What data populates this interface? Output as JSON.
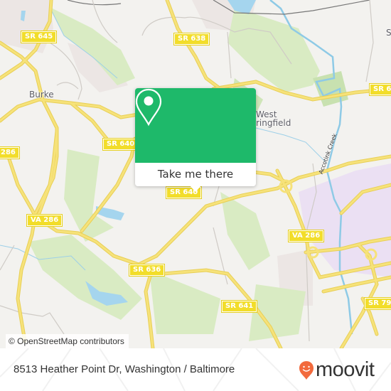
{
  "map": {
    "road_labels": [
      {
        "id": "sr645",
        "text": "SR 645"
      },
      {
        "id": "sr638",
        "text": "SR 638"
      },
      {
        "id": "sr64x",
        "text": "SR 64"
      },
      {
        "id": "va286-w",
        "text": "286"
      },
      {
        "id": "sr640-w",
        "text": "SR 640"
      },
      {
        "id": "sr640-c",
        "text": "SR 640"
      },
      {
        "id": "va286-sw",
        "text": "VA 286"
      },
      {
        "id": "va286-e",
        "text": "VA 286"
      },
      {
        "id": "sr636",
        "text": "SR 636"
      },
      {
        "id": "sr641",
        "text": "SR 641"
      },
      {
        "id": "sr79x",
        "text": "SR 79"
      }
    ],
    "place_labels": [
      {
        "id": "burke",
        "text": "Burke"
      },
      {
        "id": "west",
        "text": "West"
      },
      {
        "id": "springfield",
        "text": "ringfield"
      },
      {
        "id": "s-edge",
        "text": "S"
      }
    ],
    "water_labels": [
      {
        "id": "accotink-creek",
        "text": "Accotink Creek"
      }
    ],
    "attribution": "© OpenStreetMap contributors",
    "colors": {
      "background": "#f3f2ef",
      "park": "#d9ebc3",
      "water": "#a5d5ee",
      "road": "#f6e27a",
      "road_label": "#f2dd2a",
      "industrial": "#ebe0f3"
    }
  },
  "popup": {
    "icon": "map-pin-icon",
    "cta_label": "Take me there",
    "accent_color": "#1eb96a"
  },
  "footer": {
    "address": "8513 Heather Point Dr, Washington / Baltimore",
    "brand": "moovit",
    "brand_color": "#f26a3d"
  }
}
